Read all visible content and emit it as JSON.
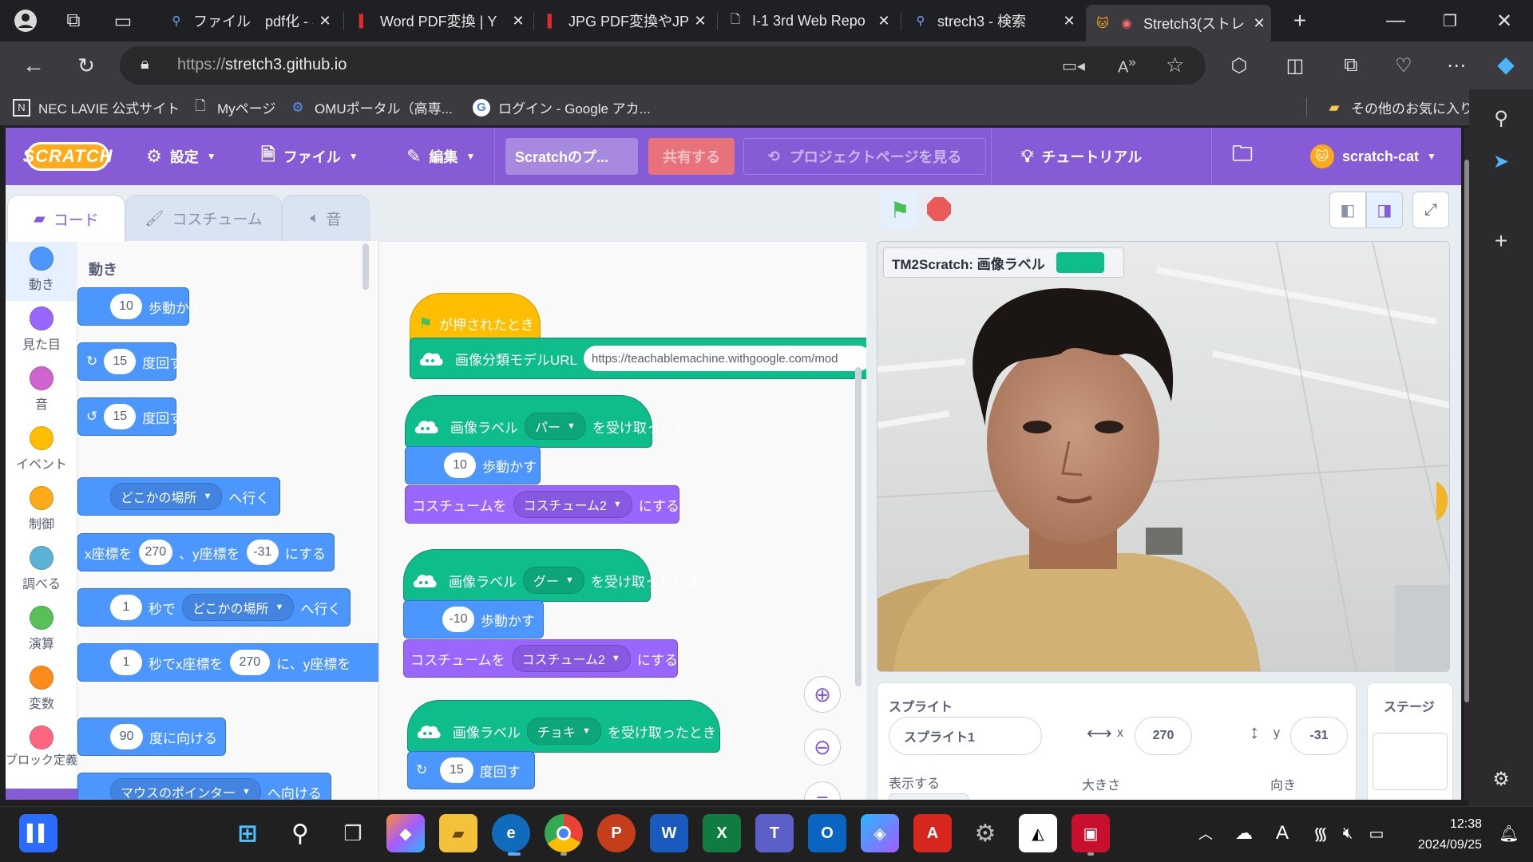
{
  "browser": {
    "tabs": [
      {
        "title": "ファイル　pdf化 - 検",
        "icon": "search-icon"
      },
      {
        "title": "Word PDF変換 | Y",
        "icon": "pdf-icon"
      },
      {
        "title": "JPG PDF変換やJPG",
        "icon": "pdf-icon"
      },
      {
        "title": "I-1 3rd Web Repo",
        "icon": "document-icon"
      },
      {
        "title": "strech3 - 検索",
        "icon": "search-icon"
      },
      {
        "title": "Stretch3(ストレ",
        "icon": "cat-icon"
      }
    ],
    "url_prefix": "https://",
    "url_host": "stretch3.github.io",
    "bookmarks": [
      "NEC LAVIE 公式サイト",
      "Myページ",
      "OMUポータル（高専...",
      "ログイン - Google アカ..."
    ],
    "other_bookmarks": "その他のお気に入り"
  },
  "scratch": {
    "logo": "SCRATCH",
    "menu": {
      "settings": "設定",
      "file": "ファイル",
      "edit": "編集",
      "project_title": "Scratchのプ...",
      "share": "共有する",
      "project_page": "プロジェクトページを見る",
      "tutorials": "チュートリアル",
      "username": "scratch-cat"
    },
    "tabs": {
      "code": "コード",
      "costumes": "コスチューム",
      "sounds": "音"
    },
    "categories": [
      {
        "label": "動き",
        "color": "#4c97ff"
      },
      {
        "label": "見た目",
        "color": "#9966ff"
      },
      {
        "label": "音",
        "color": "#cf63cf"
      },
      {
        "label": "イベント",
        "color": "#ffbf00"
      },
      {
        "label": "制御",
        "color": "#ffab19"
      },
      {
        "label": "調べる",
        "color": "#5cb1d6"
      },
      {
        "label": "演算",
        "color": "#59c059"
      },
      {
        "label": "変数",
        "color": "#ff8c1a"
      },
      {
        "label": "ブロック定義",
        "color": "#ff6680"
      }
    ],
    "palette": {
      "heading": "動き",
      "move": {
        "value": "10",
        "text": "歩動かす"
      },
      "turn_right": {
        "value": "15",
        "text": "度回す"
      },
      "turn_left": {
        "value": "15",
        "text": "度回す"
      },
      "goto": {
        "dropdown": "どこかの場所",
        "text": "へ行く"
      },
      "gotoxy": {
        "xlabel": "x座標を",
        "x": "270",
        "sep": "、y座標を",
        "y": "-31",
        "text": "にする"
      },
      "glide": {
        "secs": "1",
        "mid": "秒で",
        "dropdown": "どこかの場所",
        "text": "へ行く"
      },
      "glidexy": {
        "secs": "1",
        "mid": "秒でx座標を",
        "x": "270",
        "text": "に、y座標を"
      },
      "point": {
        "value": "90",
        "text": "度に向ける"
      },
      "pointto": {
        "dropdown": "マウスのポインター",
        "text": "へ向ける"
      }
    },
    "script": {
      "flag_hat": "が押されたとき",
      "model_url_label": "画像分類モデルURL",
      "model_url": "https://teachablemachine.withgoogle.com/mod",
      "when1": {
        "label": "画像ラベル",
        "dropdown": "パー",
        "text": "を受け取ったとき"
      },
      "move1": {
        "value": "10",
        "text": "歩動かす"
      },
      "costume1": {
        "label": "コスチュームを",
        "dropdown": "コスチューム2",
        "text": "にする"
      },
      "when2": {
        "label": "画像ラベル",
        "dropdown": "グー",
        "text": "を受け取ったとき"
      },
      "move2": {
        "value": "-10",
        "text": "歩動かす"
      },
      "costume2": {
        "label": "コスチュームを",
        "dropdown": "コスチューム2",
        "text": "にする"
      },
      "when3": {
        "label": "画像ラベル",
        "dropdown": "チョキ",
        "text": "を受け取ったとき"
      },
      "turn3": {
        "value": "15",
        "text": "度回す"
      }
    },
    "stage": {
      "monitor_label": "TM2Scratch: 画像ラベル"
    },
    "sprite_pane": {
      "title": "スプライト",
      "name": "スプライト1",
      "x_label": "x",
      "x": "270",
      "y_label": "y",
      "y": "-31",
      "show_label": "表示する",
      "size_label": "大きさ",
      "direction_label": "向き"
    },
    "stage_pane": {
      "title": "ステージ"
    }
  },
  "taskbar": {
    "apps": [
      "start-icon",
      "search-icon",
      "task-view-icon",
      "copilot-icon",
      "file-explorer-icon",
      "edge-icon",
      "chrome-icon",
      "powerpoint-icon",
      "word-icon",
      "excel-icon",
      "teams-icon",
      "outlook-icon",
      "copilot-app-icon",
      "acrobat-icon",
      "settings-icon",
      "capcut-icon",
      "pdf-app-icon"
    ],
    "time": "12:38",
    "date": "2024/09/25"
  }
}
